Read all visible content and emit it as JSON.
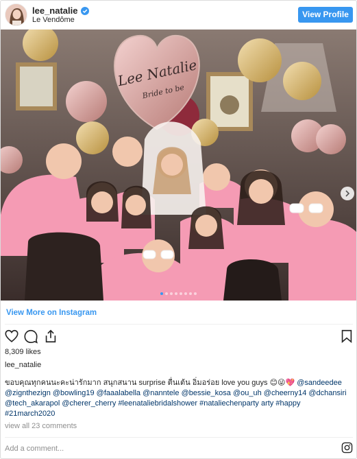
{
  "header": {
    "username": "lee_natalie",
    "location": "Le Vendôme",
    "view_profile_label": "View Profile"
  },
  "photo": {
    "balloon_text_line1": "Lee Natalie",
    "balloon_text_line2": "Bride to be",
    "carousel_dot_count": 8,
    "carousel_active_index": 0,
    "accent_shirt_color": "#f59bb4"
  },
  "view_more_label": "View More on Instagram",
  "actions": {
    "like_icon": "heart-icon",
    "comment_icon": "comment-icon",
    "share_icon": "share-icon",
    "save_icon": "bookmark-icon"
  },
  "likes_text": "8,309 likes",
  "owner_text": "lee_natalie",
  "caption": {
    "text": "ขอบคุณทุกคนนะคะน่ารักมาก สนุกสนาน surprise ตื่นเต้น อิ่มอร่อย love you guys 😊😜💖 ",
    "mentions": [
      "@sandeedee",
      "@zignthezign",
      "@bowling19",
      "@faaalabella",
      "@nanntele",
      "@bessie_kosa",
      "@ou_uh",
      "@cheerny14",
      "@dchansiri",
      "@tech_akarapol",
      "@cherer_cherry"
    ],
    "hashtags": [
      "#leenataliebridalshower",
      "#nataliechenparty arty",
      "#happy",
      "#21march2020"
    ]
  },
  "view_all_comments": "view all 23 comments",
  "add_comment_placeholder": "Add a comment...",
  "brand_color": "#3897f0"
}
